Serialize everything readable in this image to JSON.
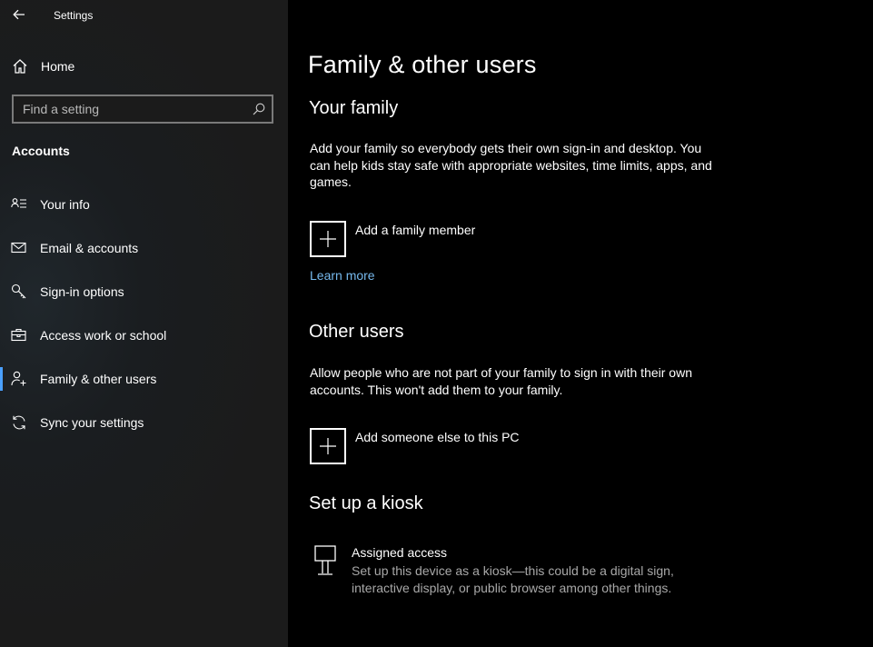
{
  "window": {
    "title": "Settings"
  },
  "sidebar": {
    "home_label": "Home",
    "search": {
      "placeholder": "Find a setting",
      "value": ""
    },
    "section_label": "Accounts",
    "items": [
      {
        "label": "Your info",
        "icon": "contact-card-icon"
      },
      {
        "label": "Email & accounts",
        "icon": "mail-icon"
      },
      {
        "label": "Sign-in options",
        "icon": "key-icon"
      },
      {
        "label": "Access work or school",
        "icon": "briefcase-icon"
      },
      {
        "label": "Family & other users",
        "icon": "add-person-icon",
        "active": true
      },
      {
        "label": "Sync your settings",
        "icon": "sync-icon"
      }
    ],
    "accent_color": "#4aa0ff"
  },
  "main": {
    "title": "Family & other users",
    "family": {
      "heading": "Your family",
      "description": "Add your family so everybody gets their own sign-in and desktop. You can help kids stay safe with appropriate websites, time limits, apps, and games.",
      "add_label": "Add a family member",
      "learn_more": "Learn more"
    },
    "other_users": {
      "heading": "Other users",
      "description": "Allow people who are not part of your family to sign in with their own accounts. This won't add them to your family.",
      "add_label": "Add someone else to this PC"
    },
    "kiosk": {
      "heading": "Set up a kiosk",
      "title": "Assigned access",
      "subtitle": "Set up this device as a kiosk—this could be a digital sign, interactive display, or public browser among other things."
    },
    "link_color": "#76b9ed"
  }
}
